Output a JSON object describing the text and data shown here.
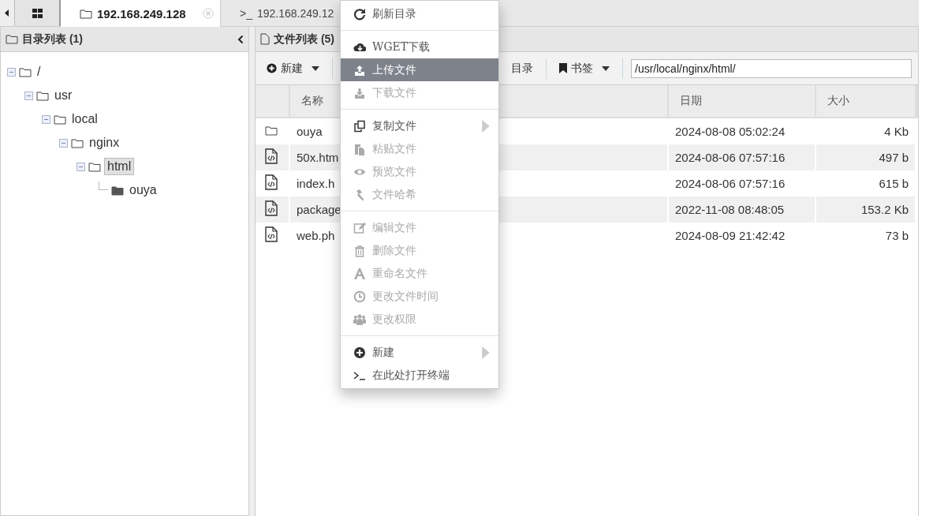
{
  "tabs": [
    {
      "label": "192.168.249.128",
      "kind": "folder",
      "selected": true,
      "closable": true
    },
    {
      "label": "192.168.249.12",
      "kind": "terminal",
      "selected": false,
      "closable": false
    }
  ],
  "terminal_glyph": ">_",
  "dir_panel": {
    "title": "目录列表 (1)",
    "tree": [
      {
        "label": "/",
        "selected": false,
        "children": [
          {
            "label": "usr",
            "selected": false,
            "children": [
              {
                "label": "local",
                "selected": false,
                "children": [
                  {
                    "label": "nginx",
                    "selected": false,
                    "children": [
                      {
                        "label": "html",
                        "selected": true,
                        "children": [
                          {
                            "label": "ouya",
                            "selected": false
                          }
                        ]
                      }
                    ]
                  }
                ]
              }
            ]
          }
        ]
      }
    ]
  },
  "file_panel": {
    "title": "文件列表 (5)",
    "toolbar": [
      {
        "label": "新建",
        "kind": "new"
      },
      {
        "label": "目录",
        "kind": "plain"
      },
      {
        "label": "书签",
        "kind": "bookmark"
      }
    ],
    "path": "/usr/local/nginx/html/",
    "columns": [
      "名称",
      "日期",
      "大小"
    ],
    "rows": [
      {
        "kind": "folder",
        "name": "ouya",
        "date": "2024-08-08 05:02:24",
        "size": "4 Kb"
      },
      {
        "kind": "file",
        "name": "50x.htm",
        "date": "2024-08-06 07:57:16",
        "size": "497 b"
      },
      {
        "kind": "file",
        "name": "index.h",
        "date": "2024-08-06 07:57:16",
        "size": "615 b"
      },
      {
        "kind": "file",
        "name": "package",
        "date": "2022-11-08 08:48:05",
        "size": "153.2 Kb"
      },
      {
        "kind": "file",
        "name": "web.ph",
        "date": "2024-08-09 21:42:42",
        "size": "73 b"
      }
    ]
  },
  "context_menu": [
    {
      "kind": "item",
      "label": "刷新目录",
      "disabled": false,
      "selected": false,
      "submenu": false
    },
    {
      "kind": "separator"
    },
    {
      "kind": "item",
      "label": "WGET下载",
      "disabled": false,
      "selected": false,
      "submenu": false
    },
    {
      "kind": "item",
      "label": "上传文件",
      "disabled": false,
      "selected": true,
      "submenu": false
    },
    {
      "kind": "item",
      "label": "下载文件",
      "disabled": true,
      "selected": false,
      "submenu": false
    },
    {
      "kind": "separator"
    },
    {
      "kind": "item",
      "label": "复制文件",
      "disabled": false,
      "selected": false,
      "submenu": true
    },
    {
      "kind": "item",
      "label": "粘贴文件",
      "disabled": true,
      "selected": false,
      "submenu": false
    },
    {
      "kind": "item",
      "label": "预览文件",
      "disabled": true,
      "selected": false,
      "submenu": false
    },
    {
      "kind": "item",
      "label": "文件哈希",
      "disabled": true,
      "selected": false,
      "submenu": false
    },
    {
      "kind": "separator"
    },
    {
      "kind": "item",
      "label": "编辑文件",
      "disabled": true,
      "selected": false,
      "submenu": false
    },
    {
      "kind": "item",
      "label": "删除文件",
      "disabled": true,
      "selected": false,
      "submenu": false
    },
    {
      "kind": "item",
      "label": "重命名文件",
      "disabled": true,
      "selected": false,
      "submenu": false
    },
    {
      "kind": "item",
      "label": "更改文件时间",
      "disabled": true,
      "selected": false,
      "submenu": false
    },
    {
      "kind": "item",
      "label": "更改权限",
      "disabled": true,
      "selected": false,
      "submenu": false
    },
    {
      "kind": "separator"
    },
    {
      "kind": "item",
      "label": "新建",
      "disabled": false,
      "selected": false,
      "submenu": true
    },
    {
      "kind": "item",
      "label": "在此处打开终端",
      "disabled": false,
      "selected": false,
      "submenu": false
    }
  ]
}
